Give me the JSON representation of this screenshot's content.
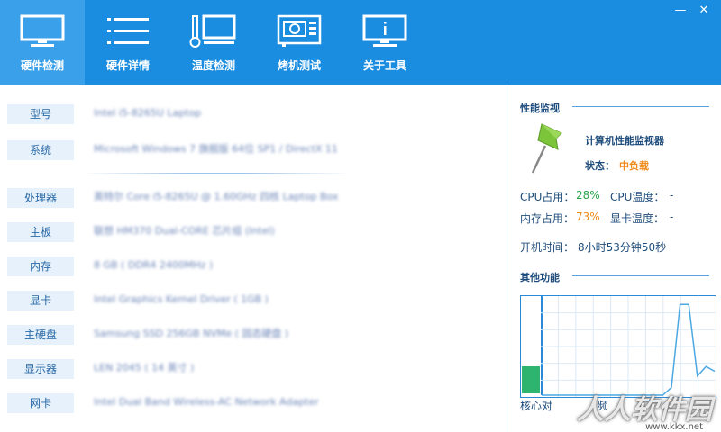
{
  "window": {
    "minimize": "—",
    "close": "✕"
  },
  "tabs": [
    {
      "label": "硬件检测",
      "icon": "monitor-icon",
      "active": true
    },
    {
      "label": "硬件详情",
      "icon": "list-icon",
      "active": false
    },
    {
      "label": "温度检测",
      "icon": "thermometer-monitor-icon",
      "active": false
    },
    {
      "label": "烤机测试",
      "icon": "gpu-card-icon",
      "active": false
    },
    {
      "label": "关于工具",
      "icon": "info-monitor-icon",
      "active": false
    }
  ],
  "hardware": [
    {
      "label": "型号",
      "value": "Intel i5-8265U Laptop"
    },
    {
      "label": "系统",
      "value": "Microsoft Windows 7 旗舰版 64位 SP1 / DirectX 11"
    },
    {
      "label": "处理器",
      "value": "英特尔 Core i5-8265U @ 1.60GHz 四核 Laptop Box"
    },
    {
      "label": "主板",
      "value": "联想 HM370 Dual-CORE 芯片组 (Intel)"
    },
    {
      "label": "内存",
      "value": "8 GB ( DDR4 2400MHz )"
    },
    {
      "label": "显卡",
      "value": "Intel Graphics Kernel Driver ( 1GB )"
    },
    {
      "label": "主硬盘",
      "value": "Samsung SSD 256GB NVMe ( 固态硬盘 )"
    },
    {
      "label": "显示器",
      "value": "LEN 2045 ( 14 英寸 )"
    },
    {
      "label": "网卡",
      "value": "Intel Dual Band Wireless-AC Network Adapter"
    }
  ],
  "monitor": {
    "section_title": "性能监视",
    "app_title": "计算机性能监视器",
    "status_label": "状态：",
    "status_value": "中负载",
    "cpu_usage_label": "CPU占用：",
    "cpu_usage_value": "28%",
    "cpu_temp_label": "CPU温度：",
    "cpu_temp_value": "-",
    "mem_usage_label": "内存占用：",
    "mem_usage_value": "73%",
    "gpu_temp_label": "显卡温度：",
    "gpu_temp_value": "-",
    "uptime_label": "开机时间：",
    "uptime_value": "8小时53分钟50秒"
  },
  "other": {
    "section_title": "其他功能",
    "legend_left": "核心对",
    "legend_right": "频"
  },
  "chart_data": {
    "type": "line",
    "bar_fraction": 0.28,
    "x": [
      0,
      1,
      2,
      3,
      4,
      5,
      6,
      7,
      8,
      9,
      10,
      11,
      12,
      13,
      14,
      15,
      16,
      17,
      18,
      19,
      20
    ],
    "values": [
      0,
      0,
      0,
      0,
      0,
      0,
      0,
      0,
      0,
      0,
      0,
      0,
      0,
      0,
      0,
      8,
      95,
      95,
      20,
      30,
      25
    ],
    "ylim": [
      0,
      100
    ]
  },
  "colors": {
    "accent": "#1a8de0",
    "green": "#2aa44a",
    "orange": "#f08a1c",
    "text": "#1e4c7c"
  },
  "watermark": {
    "text": "人人软件园",
    "url": "www.kkx.net"
  }
}
